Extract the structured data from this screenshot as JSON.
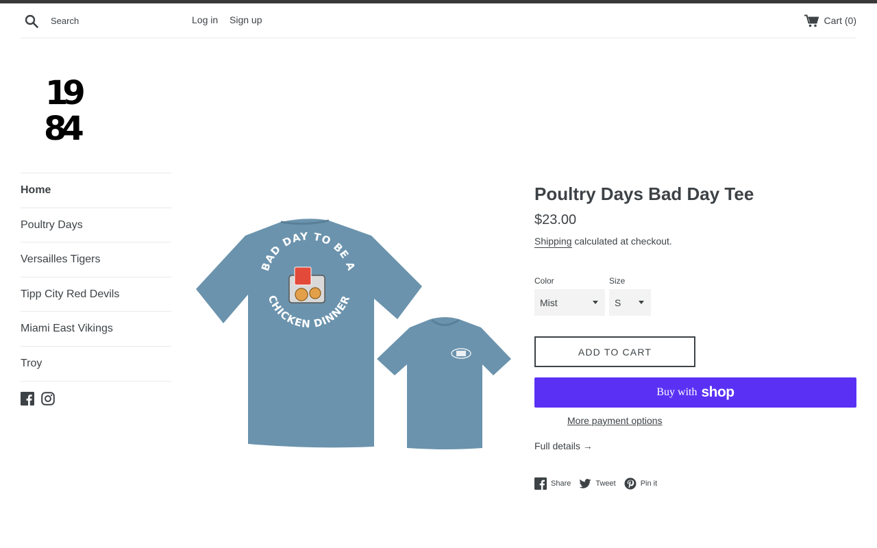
{
  "header": {
    "search": {
      "placeholder": "Search",
      "value": ""
    },
    "login_label": "Log in",
    "signup_label": "Sign up",
    "cart_label": "Cart (0)"
  },
  "logo": {
    "text_top": "19",
    "text_bottom": "84"
  },
  "sidebar": {
    "items": [
      {
        "label": "Home",
        "active": true
      },
      {
        "label": "Poultry Days",
        "active": false
      },
      {
        "label": "Versailles Tigers",
        "active": false
      },
      {
        "label": "Tipp City Red Devils",
        "active": false
      },
      {
        "label": "Miami East Vikings",
        "active": false
      },
      {
        "label": "Troy",
        "active": false
      }
    ],
    "social_icons": [
      "facebook-icon",
      "instagram-icon"
    ]
  },
  "product": {
    "title": "Poultry Days Bad Day Tee",
    "price": "$23.00",
    "shipping_link": "Shipping",
    "shipping_text": " calculated at checkout.",
    "options": {
      "color_label": "Color",
      "color_value": "Mist",
      "size_label": "Size",
      "size_value": "S"
    },
    "add_to_cart_label": "ADD TO CART",
    "buy_with_label": "Buy with",
    "buy_brand": "shop",
    "more_payment_label": "More payment options",
    "full_details_label": "Full details →",
    "shirt_print_top": "BAD DAY TO BE A",
    "shirt_print_bottom": "CHICKEN DINNER",
    "shirt_color": "#6b93ad"
  },
  "share": {
    "share_label": "Share",
    "tweet_label": "Tweet",
    "pin_label": "Pin it"
  },
  "colors": {
    "text": "#3d4246",
    "shop_pay": "#5a31f4",
    "border": "#e8e9eb"
  }
}
